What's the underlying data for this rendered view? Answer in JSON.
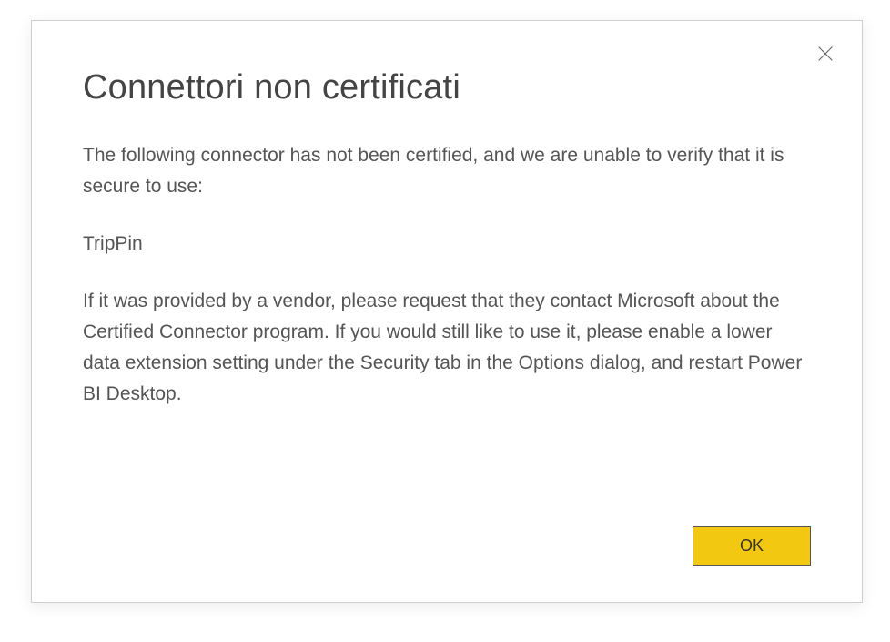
{
  "dialog": {
    "title": "Connettori non certificati",
    "intro_text": "The following connector has not been certified, and we are unable to verify that it is secure to use:",
    "connector_name": "TripPin",
    "detail_text": "If it was provided by a vendor, please request that they contact Microsoft about the Certified Connector program. If you would still like to use it, please enable a lower data extension setting under the Security tab in the Options dialog, and restart Power BI Desktop.",
    "ok_label": "OK"
  }
}
